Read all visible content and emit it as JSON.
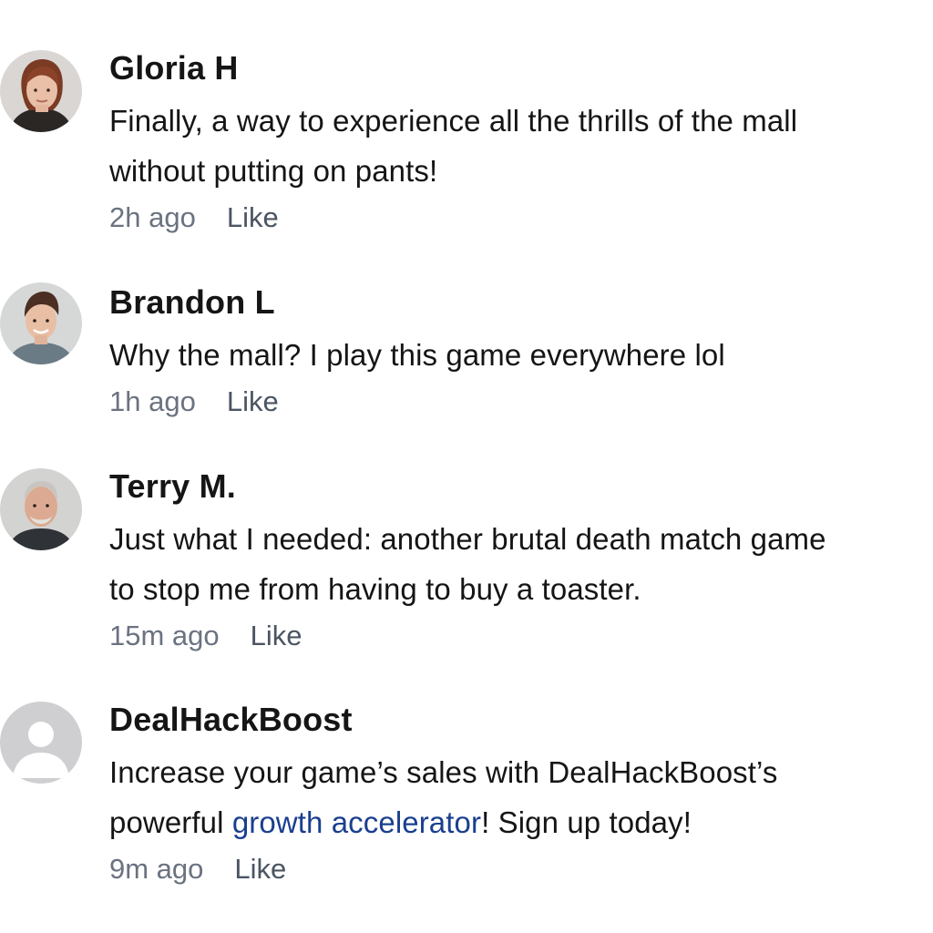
{
  "comments": [
    {
      "author": "Gloria H",
      "lines": [
        "Finally, a way to experience all the thrills of the mall",
        "without putting on pants!"
      ],
      "time": "2h ago",
      "like_label": "Like",
      "avatar_icon": "woman-portrait-avatar"
    },
    {
      "author": "Brandon L",
      "lines": [
        "Why the mall? I play this game everywhere lol"
      ],
      "time": "1h ago",
      "like_label": "Like",
      "avatar_icon": "man-portrait-avatar"
    },
    {
      "author": "Terry M.",
      "lines": [
        "Just what I needed: another brutal death match game",
        "to stop me from having to buy a toaster."
      ],
      "time": "15m ago",
      "like_label": "Like",
      "avatar_icon": "older-man-portrait-avatar"
    },
    {
      "author": "DealHackBoost",
      "lines": [
        "Increase your game’s sales with DealHackBoost’s"
      ],
      "line2_before_link": "powerful ",
      "link_text": "growth accelerator",
      "line2_after_link": "! Sign up today!",
      "time": "9m ago",
      "like_label": "Like",
      "avatar_icon": "default-user-avatar"
    }
  ],
  "colors": {
    "link": "#1a3f8f",
    "meta": "#6b7280",
    "text": "#151515"
  }
}
